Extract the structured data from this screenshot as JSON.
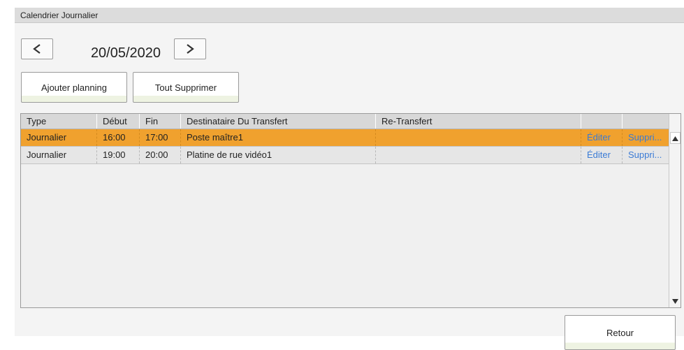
{
  "window": {
    "title": "Calendrier Journalier"
  },
  "date_nav": {
    "prev_icon": "chevron-left-icon",
    "date": "20/05/2020",
    "next_icon": "chevron-right-icon"
  },
  "actions": {
    "add_label": "Ajouter planning",
    "delete_all_label": "Tout Supprimer"
  },
  "table": {
    "columns": [
      "Type",
      "Début",
      "Fin",
      "Destinataire Du Transfert",
      "Re-Transfert",
      "",
      ""
    ],
    "rows": [
      {
        "type": "Journalier",
        "start": "16:00",
        "end": "17:00",
        "recipient": "Poste maître1",
        "retransfer": "",
        "edit": "Éditer",
        "delete": "Suppri...",
        "selected": true
      },
      {
        "type": "Journalier",
        "start": "19:00",
        "end": "20:00",
        "recipient": "Platine de rue vidéo1",
        "retransfer": "",
        "edit": "Éditer",
        "delete": "Suppri...",
        "selected": false
      }
    ]
  },
  "footer": {
    "back_label": "Retour"
  },
  "colors": {
    "selected_row": "#f0a12e",
    "link": "#3a7bd5",
    "header": "#d8d8d8"
  }
}
